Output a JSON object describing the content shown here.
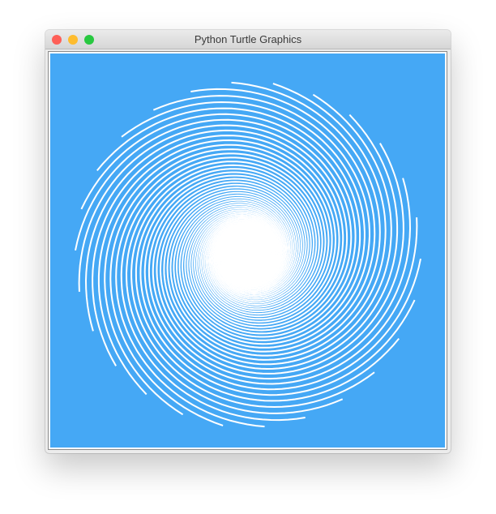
{
  "window": {
    "title": "Python Turtle Graphics"
  },
  "controls": {
    "close_color": "#fe5f57",
    "minimize_color": "#febc2e",
    "zoom_color": "#28c840"
  },
  "canvas": {
    "background_color": "#ffffff",
    "fill_color": "#45a8f5",
    "line_color": "#ffffff",
    "spiral_arms": 26,
    "drawing": "spiral"
  }
}
